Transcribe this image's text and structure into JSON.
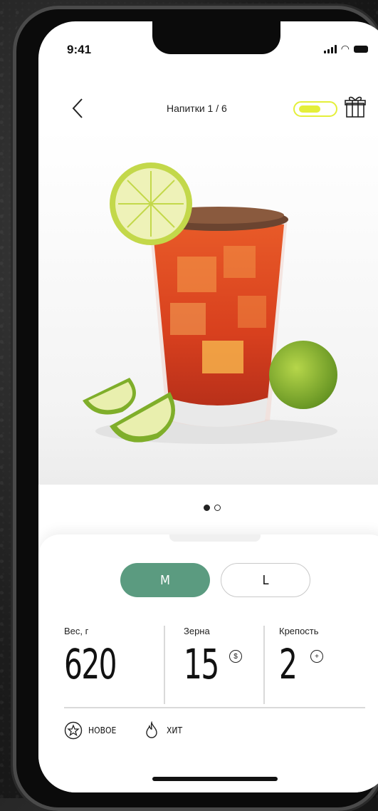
{
  "status_bar": {
    "time": "9:41"
  },
  "header": {
    "title": "Напитки 1 / 6"
  },
  "colors": {
    "accent_green": "#5b9b80",
    "toggle_yellow": "#e4ef3a"
  },
  "product": {
    "image_icon": "cocktail-glass-with-lime",
    "gallery_page": 1,
    "gallery_total": 2
  },
  "sizes": {
    "selected": "M",
    "options": [
      "M",
      "L"
    ]
  },
  "stats": [
    {
      "label": "Вес, г",
      "value": "620",
      "icon": ""
    },
    {
      "label": "Зерна",
      "value": "15",
      "icon": "coin-icon"
    },
    {
      "label": "Крепость",
      "value": "2",
      "icon": "plus-circle-icon"
    }
  ],
  "tags": [
    {
      "label": "НОВОЕ",
      "icon": "star-badge-icon"
    },
    {
      "label": "ХИТ",
      "icon": "flame-icon"
    }
  ]
}
